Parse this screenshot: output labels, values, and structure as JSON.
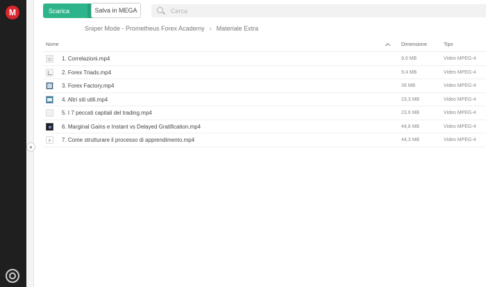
{
  "app": {
    "logo_letter": "M"
  },
  "toolbar": {
    "download_label": "Scarica",
    "save_label": "Salva in MEGA"
  },
  "search": {
    "placeholder": "Cerca",
    "value": ""
  },
  "breadcrumb": {
    "items": [
      "Sniper Mode - Prometheus Forex Academy",
      "Materiale Extra"
    ],
    "separator": "›"
  },
  "table": {
    "headers": {
      "name": "Nome",
      "size": "Dimensione",
      "type": "Tipo"
    },
    "sort": {
      "column": "name",
      "direction": "ascending"
    },
    "rows": [
      {
        "name": "1. Correlazioni.mp4",
        "size": "8,6 MB",
        "type": "Video MPEG-4",
        "thumb": "doc"
      },
      {
        "name": "2. Forex Triads.mp4",
        "size": "9,4 MB",
        "type": "Video MPEG-4",
        "thumb": "chart"
      },
      {
        "name": "3. Forex Factory.mp4",
        "size": "39 MB",
        "type": "Video MPEG-4",
        "thumb": "screen"
      },
      {
        "name": "4. Altri siti utili.mp4",
        "size": "23,3 MB",
        "type": "Video MPEG-4",
        "thumb": "teal"
      },
      {
        "name": "5. I 7 peccati capitali del trading.mp4",
        "size": "23,6 MB",
        "type": "Video MPEG-4",
        "thumb": "light"
      },
      {
        "name": "6. Marginal Gains e Instant vs Delayed Gratification.mp4",
        "size": "44,8 MB",
        "type": "Video MPEG-4",
        "thumb": "dark"
      },
      {
        "name": "7. Come strutturare il processo di apprendimento.mp4",
        "size": "44,3 MB",
        "type": "Video MPEG-4",
        "thumb": "video"
      }
    ]
  },
  "colors": {
    "brand_red": "#d9272e",
    "download_green": "#2eb48a",
    "rail_dark": "#1f1f1f"
  }
}
